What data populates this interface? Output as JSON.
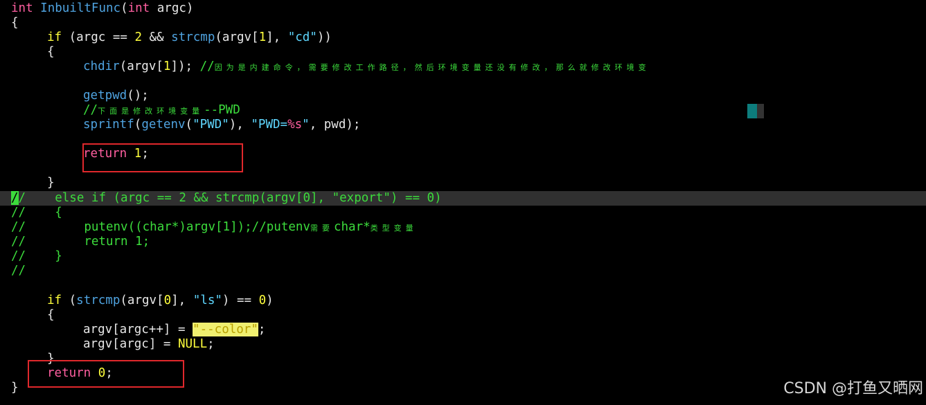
{
  "editor": {
    "lines": [
      {
        "id": "l1",
        "parts": [
          [
            "kw",
            "int"
          ],
          [
            "def",
            " "
          ],
          [
            "fn",
            "InbuiltFunc"
          ],
          [
            "def",
            "("
          ],
          [
            "kw",
            "int"
          ],
          [
            "def",
            " argc)"
          ]
        ]
      },
      {
        "id": "l2",
        "parts": [
          [
            "def",
            "{"
          ]
        ]
      },
      {
        "id": "l3",
        "parts": [
          [
            "ctl",
            "if"
          ],
          [
            "def",
            " (argc == "
          ],
          [
            "num",
            "2"
          ],
          [
            "def",
            " && "
          ],
          [
            "fn",
            "strcmp"
          ],
          [
            "def",
            "(argv["
          ],
          [
            "num",
            "1"
          ],
          [
            "def",
            "], "
          ],
          [
            "str",
            "\"cd\""
          ],
          [
            "def",
            "))"
          ]
        ]
      },
      {
        "id": "l4",
        "parts": [
          [
            "def",
            "{"
          ]
        ]
      },
      {
        "id": "l5",
        "parts": [
          [
            "fn",
            "chdir"
          ],
          [
            "def",
            "(argv["
          ],
          [
            "num",
            "1"
          ],
          [
            "def",
            "]); "
          ],
          [
            "cmt",
            "//"
          ],
          [
            "cjk",
            "因为是内建命令，需要修改工作路径，然后环境变量还没有修改，那么就修改环境变"
          ]
        ]
      },
      {
        "id": "l6",
        "parts": []
      },
      {
        "id": "l7",
        "parts": [
          [
            "fn",
            "getpwd"
          ],
          [
            "def",
            "();"
          ]
        ]
      },
      {
        "id": "l8",
        "parts": [
          [
            "cmt",
            "//"
          ],
          [
            "cjk",
            "下面是修改环境变量"
          ],
          [
            "cmt",
            "--PWD"
          ]
        ]
      },
      {
        "id": "l9",
        "parts": [
          [
            "fn",
            "sprintf"
          ],
          [
            "def",
            "("
          ],
          [
            "fn",
            "getenv"
          ],
          [
            "def",
            "("
          ],
          [
            "str",
            "\"PWD\""
          ],
          [
            "def",
            "), "
          ],
          [
            "str",
            "\"PWD="
          ],
          [
            "fmt",
            "%s"
          ],
          [
            "str",
            "\""
          ],
          [
            "def",
            ", pwd);"
          ]
        ]
      },
      {
        "id": "l10",
        "parts": []
      },
      {
        "id": "l11",
        "parts": [
          [
            "kw",
            "return"
          ],
          [
            "def",
            " "
          ],
          [
            "num",
            "1"
          ],
          [
            "def",
            ";"
          ]
        ]
      },
      {
        "id": "l12",
        "parts": []
      },
      {
        "id": "l13",
        "parts": [
          [
            "def",
            "}"
          ]
        ]
      },
      {
        "id": "l14",
        "parts": [
          [
            "cur",
            "/"
          ],
          [
            "cmt",
            "/    else if (argc == 2 && strcmp(argv[0], \"export\") == 0)"
          ]
        ]
      },
      {
        "id": "l15",
        "parts": [
          [
            "cmt",
            "//    {"
          ]
        ]
      },
      {
        "id": "l16",
        "parts": [
          [
            "cmt",
            "//        putenv((char*)argv[1]);//putenv"
          ],
          [
            "cjk",
            "需要"
          ],
          [
            "cmt",
            "char*"
          ],
          [
            "cjk",
            "类型变量"
          ]
        ]
      },
      {
        "id": "l17",
        "parts": [
          [
            "cmt",
            "//        return 1;"
          ]
        ]
      },
      {
        "id": "l18",
        "parts": [
          [
            "cmt",
            "//    }"
          ]
        ]
      },
      {
        "id": "l19",
        "parts": [
          [
            "cmt",
            "//"
          ]
        ]
      },
      {
        "id": "l20",
        "parts": []
      },
      {
        "id": "l21",
        "parts": [
          [
            "ctl",
            "if"
          ],
          [
            "def",
            " ("
          ],
          [
            "fn",
            "strcmp"
          ],
          [
            "def",
            "(argv["
          ],
          [
            "num",
            "0"
          ],
          [
            "def",
            "], "
          ],
          [
            "str",
            "\"ls\""
          ],
          [
            "def",
            ") == "
          ],
          [
            "num",
            "0"
          ],
          [
            "def",
            ")"
          ]
        ]
      },
      {
        "id": "l22",
        "parts": [
          [
            "def",
            "{"
          ]
        ]
      },
      {
        "id": "l23",
        "parts": [
          [
            "def",
            "argv[argc++] = "
          ],
          [
            "hl",
            "\"--color\""
          ],
          [
            "def",
            ";"
          ]
        ]
      },
      {
        "id": "l24",
        "parts": [
          [
            "def",
            "argv[argc] = "
          ],
          [
            "null",
            "NULL"
          ],
          [
            "def",
            ";"
          ]
        ]
      },
      {
        "id": "l25",
        "parts": [
          [
            "def",
            "}"
          ]
        ]
      },
      {
        "id": "l26",
        "parts": [
          [
            "kw",
            "return"
          ],
          [
            "def",
            " "
          ],
          [
            "num",
            "0"
          ],
          [
            "def",
            ";"
          ]
        ]
      },
      {
        "id": "l27",
        "parts": [
          [
            "def",
            "}"
          ]
        ]
      }
    ]
  },
  "watermark": "CSDN @打鱼又晒网",
  "colors": {
    "background": "#000000",
    "keyword": "#ff5fa0",
    "control": "#ffff3c",
    "function": "#4fa3e0",
    "string": "#5fd7ff",
    "comment": "#3cdc3c",
    "highlight_box": "#e0282c"
  }
}
